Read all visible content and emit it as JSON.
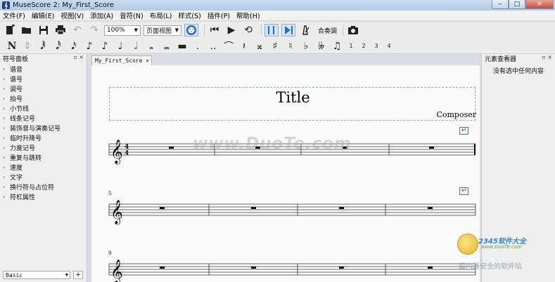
{
  "window": {
    "title": "MuseScore 2: My_First_Score",
    "controls": [
      "minimize",
      "maximize",
      "close"
    ]
  },
  "menu": [
    "文件(F)",
    "编辑(E)",
    "视图(V)",
    "添加(A)",
    "音符(N)",
    "布局(L)",
    "样式(S)",
    "插件(P)",
    "帮助(H)"
  ],
  "toolbar": {
    "zoom_value": "100%",
    "view_mode_value": "页面视图",
    "concert_pitch_label": "合奏调",
    "icons": [
      "new-file-icon",
      "open-folder-icon",
      "save-icon",
      "print-icon",
      "undo-icon",
      "redo-icon",
      "midi-input-icon",
      "rewind-icon",
      "play-icon",
      "loop-icon",
      "playback-loop-icon",
      "metronome-icon",
      "pan-score-icon",
      "image-capture-icon"
    ]
  },
  "note_input": {
    "numbers": [
      "1",
      "2",
      "3",
      "4"
    ]
  },
  "palette": {
    "header": "符号面板",
    "items": [
      "谱音",
      "谱号",
      "调号",
      "拍号",
      "小节线",
      "线条记号",
      "装饰音与演奏记号",
      "临时升降号",
      "力度记号",
      "重复与跳转",
      "速度",
      "文字",
      "换行符与占位符",
      "符杠属性"
    ],
    "workspace_value": "Basic",
    "add_label": "+"
  },
  "score": {
    "tab_label": "My_First_Score",
    "title": "Title",
    "composer": "Composer",
    "systems": [
      {
        "measure_number": "",
        "time_signature": [
          "4",
          "4"
        ]
      },
      {
        "measure_number": "5"
      },
      {
        "measure_number": "9"
      }
    ]
  },
  "inspector": {
    "header": "元素查看器",
    "empty_message": "没有选中任何内容"
  },
  "watermarks": {
    "center": "www.DuoTe.com",
    "logo_title": "2345软件大全",
    "logo_url": "www.DuoTe.com",
    "logo_caption": "国内最安全的软件站"
  }
}
